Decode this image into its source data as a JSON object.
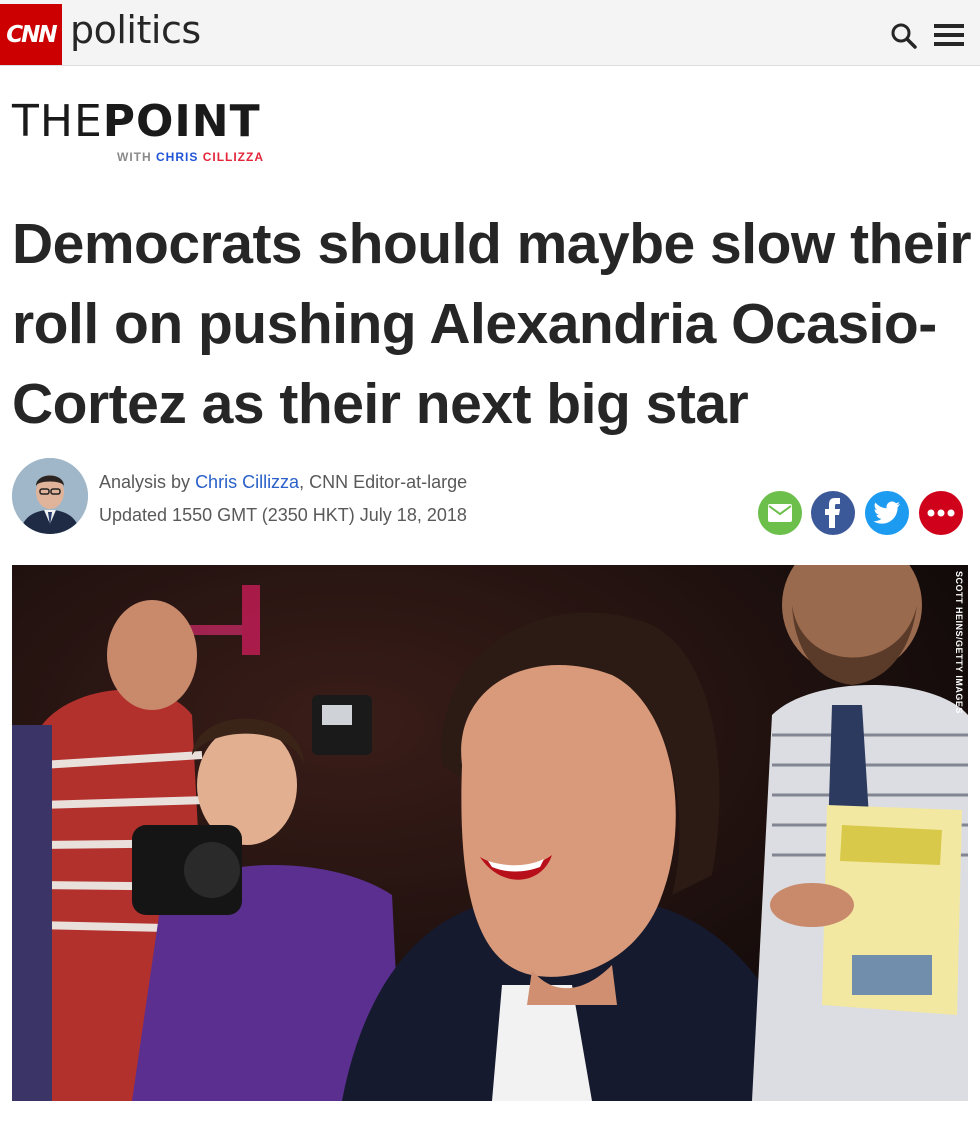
{
  "nav": {
    "logo_text": "CNN",
    "section": "politics",
    "search_icon": "search-icon",
    "menu_icon": "hamburger-menu-icon"
  },
  "brand": {
    "the": "THE",
    "point": "POINT",
    "with": "WITH",
    "first": "CHRIS",
    "last": "CILLIZZA"
  },
  "article": {
    "headline": "Democrats should maybe slow their roll on pushing Alexandria Ocasio-Cortez as their next big star",
    "byline_prefix": "Analysis by",
    "author": "Chris Cillizza",
    "byline_suffix": ", CNN Editor-at-large",
    "updated": "Updated 1550 GMT (2350 HKT) July 18, 2018"
  },
  "share": {
    "email": "email-icon",
    "facebook": "facebook-icon",
    "twitter": "twitter-icon",
    "more": "more-icon"
  },
  "photo": {
    "credit": "SCOTT HEINS/GETTY IMAGES"
  },
  "colors": {
    "cnn_red": "#cc0000",
    "link_blue": "#2a60c8",
    "email_green": "#6bbf4a",
    "facebook_blue": "#3b5998",
    "twitter_blue": "#1d9bf0",
    "more_red": "#d0021b"
  }
}
